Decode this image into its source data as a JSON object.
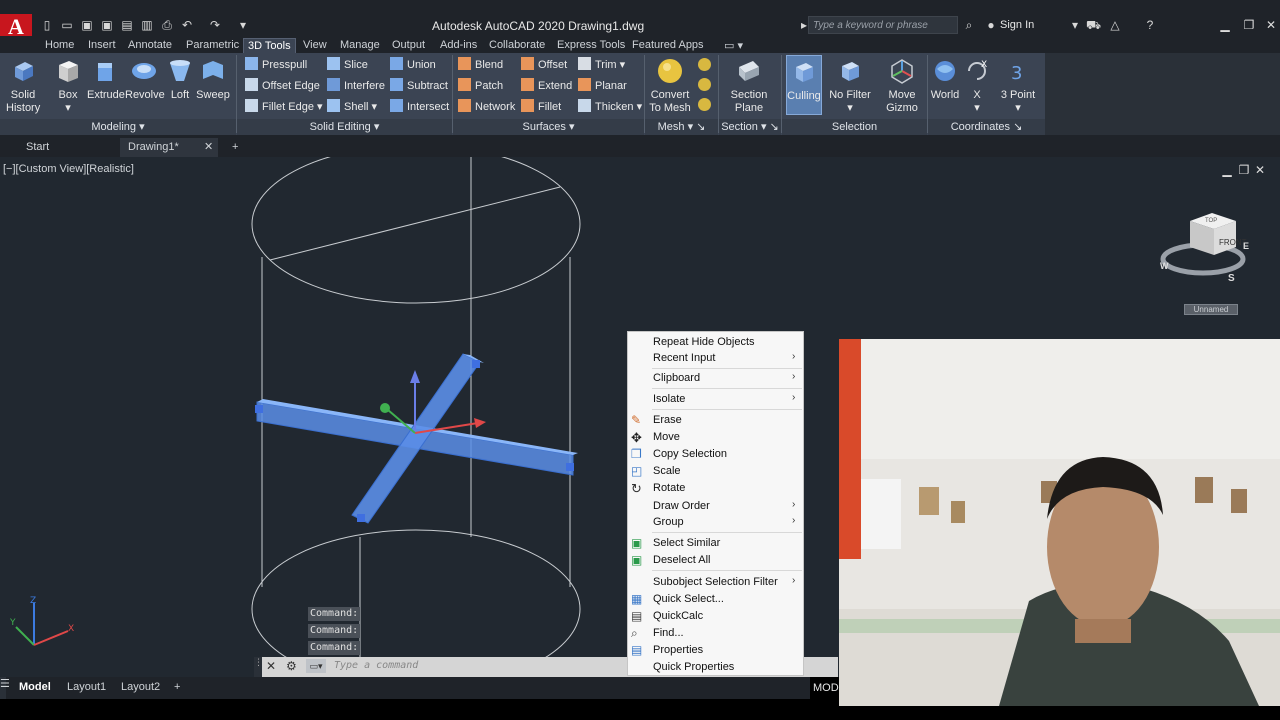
{
  "app": {
    "logo_letter": "A",
    "title": "Autodesk AutoCAD 2020   Drawing1.dwg",
    "search_placeholder": "Type a keyword or phrase",
    "sign_in": "Sign In"
  },
  "ribbon_tabs": [
    "Home",
    "Insert",
    "Annotate",
    "Parametric",
    "3D Tools",
    "View",
    "Manage",
    "Output",
    "Add-ins",
    "Collaborate",
    "Express Tools",
    "Featured Apps"
  ],
  "active_ribbon_tab": "3D Tools",
  "ribbon": {
    "modeling": {
      "title": "Modeling",
      "solid_history": "Solid History",
      "box": "Box",
      "extrude": "Extrude",
      "revolve": "Revolve",
      "loft": "Loft",
      "sweep": "Sweep"
    },
    "solid_editing": {
      "title": "Solid Editing",
      "presspull": "Presspull",
      "slice": "Slice",
      "union": "Union",
      "offset_edge": "Offset Edge",
      "interfere": "Interfere",
      "subtract": "Subtract",
      "fillet_edge": "Fillet Edge",
      "shell": "Shell",
      "intersect": "Intersect"
    },
    "surfaces": {
      "title": "Surfaces",
      "blend": "Blend",
      "offset": "Offset",
      "trim": "Trim",
      "patch": "Patch",
      "extend": "Extend",
      "planar": "Planar",
      "network": "Network",
      "fillet": "Fillet",
      "thicken": "Thicken"
    },
    "mesh": {
      "title": "Mesh",
      "convert_line1": "Convert",
      "convert_line2": "To Mesh"
    },
    "section": {
      "title": "Section",
      "plane_line1": "Section",
      "plane_line2": "Plane"
    },
    "selection": {
      "title": "Selection",
      "culling": "Culling",
      "no_filter": "No Filter",
      "move_gizmo_line1": "Move",
      "move_gizmo_line2": "Gizmo"
    },
    "coordinates": {
      "title": "Coordinates",
      "world": "World",
      "x": "X",
      "three_point": "3 Point"
    }
  },
  "file_tabs": {
    "start": "Start",
    "drawing": "Drawing1*"
  },
  "viewport": {
    "label": "[−][Custom View][Realistic]",
    "viewcube_badge": "Unnamed",
    "viewcube_face": "FRONT",
    "viewcube_top": "TOP",
    "compass_w": "W",
    "compass_s": "S",
    "compass_e": "E"
  },
  "command": {
    "history": [
      "Command:",
      "Command:",
      "Command:"
    ],
    "placeholder": "Type a command"
  },
  "context_menu": {
    "items": [
      "Repeat Hide Objects",
      "Recent Input",
      "Clipboard",
      "Isolate",
      "Erase",
      "Move",
      "Copy Selection",
      "Scale",
      "Rotate",
      "Draw Order",
      "Group",
      "Select Similar",
      "Deselect All",
      "Subobject Selection Filter",
      "Quick Select...",
      "QuickCalc",
      "Find...",
      "Properties",
      "Quick Properties"
    ]
  },
  "layout_tabs": {
    "model": "Model",
    "layout1": "Layout1",
    "layout2": "Layout2"
  },
  "status": {
    "mode": "MOD"
  },
  "colors": {
    "ribbon_bg": "#3b4453",
    "viewport_bg": "#212830",
    "selection_blue": "#5b8ee8",
    "logo_red": "#c8161e"
  }
}
